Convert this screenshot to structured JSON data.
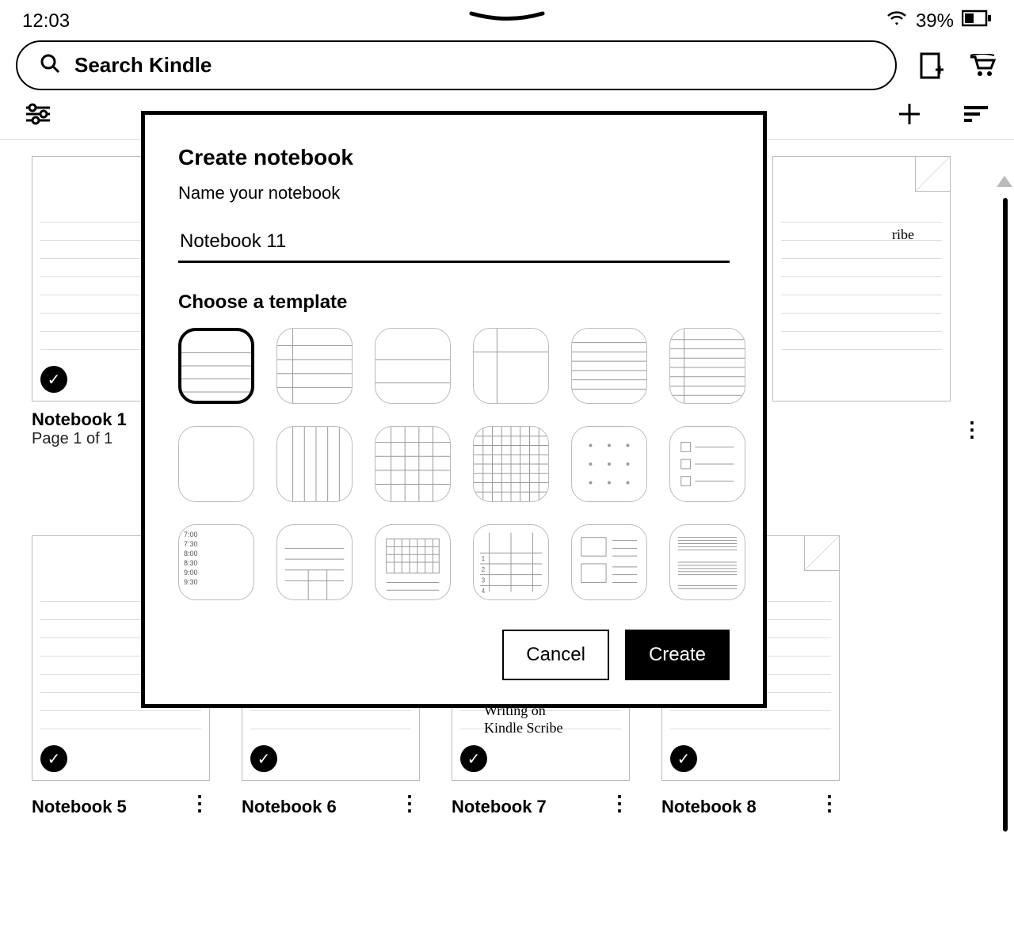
{
  "status": {
    "time": "12:03",
    "battery": "39%"
  },
  "search": {
    "placeholder": "Search Kindle"
  },
  "notebooks": {
    "row1": [
      {
        "title": "Notebook 1",
        "subtitle": "Page 1 of 1"
      }
    ],
    "row2": [
      {
        "title": "Notebook 5"
      },
      {
        "title": "Notebook 6"
      },
      {
        "title": "Notebook 7"
      },
      {
        "title": "Notebook 8"
      }
    ],
    "visible_writing": {
      "nb3_text": "ribe",
      "nb7_line1": "Writing on",
      "nb7_line2": "Kindle Scribe"
    }
  },
  "modal": {
    "title": "Create notebook",
    "name_label": "Name your notebook",
    "name_value": "Notebook 11",
    "choose_label": "Choose a template",
    "schedule_times": [
      "7:00",
      "7:30",
      "8:00",
      "8:30",
      "9:00",
      "9:30"
    ],
    "cancel_label": "Cancel",
    "create_label": "Create"
  }
}
